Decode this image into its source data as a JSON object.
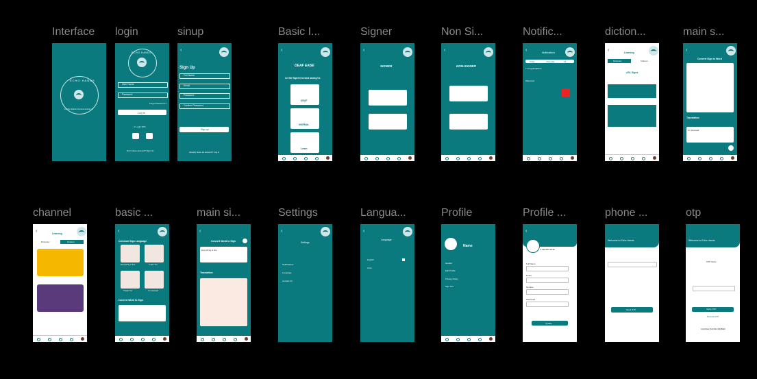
{
  "frames": [
    {
      "label": "Interface"
    },
    {
      "label": "login"
    },
    {
      "label": "sinup"
    },
    {
      "label": "Basic I..."
    },
    {
      "label": "Signer"
    },
    {
      "label": "Non Si..."
    },
    {
      "label": "Notific..."
    },
    {
      "label": "diction..."
    },
    {
      "label": "main s..."
    },
    {
      "label": "channel"
    },
    {
      "label": "basic ..."
    },
    {
      "label": "main si..."
    },
    {
      "label": "Settings"
    },
    {
      "label": "Langua..."
    },
    {
      "label": "Profile"
    },
    {
      "label": "Profile ..."
    },
    {
      "label": "phone ..."
    },
    {
      "label": "otp"
    }
  ],
  "splash": {
    "brand": "ECHO HANDS",
    "tagline": "Let the Signers be best among us"
  },
  "login": {
    "brand": "ECHO HANDS",
    "user": "User Name",
    "password": "Password",
    "forgot": "Forgot Password ?",
    "login": "Log in",
    "or": "or Login With",
    "signup_prompt": "Don't Have account? Sign Up"
  },
  "signup": {
    "title": "Sign Up",
    "fields": [
      "Full Name",
      "Email",
      "Password",
      "Confirm Password"
    ],
    "button": "Sign up",
    "login_prompt": "Already Have an account? Log in"
  },
  "basic": {
    "title": "DEAF EASE",
    "subtitle": "Let the Signers be best among Us",
    "options": [
      "DEAF",
      "NORMAL",
      "Learn"
    ]
  },
  "signer": {
    "title": "SIGNER"
  },
  "nonsigner": {
    "title": "NON-SIGNER"
  },
  "notif": {
    "title": "Notifications",
    "tabs": [
      "Today",
      "Yesterday",
      "All"
    ],
    "items": [
      "7 Congratulations",
      "Welcome!",
      "Delete"
    ]
  },
  "dict": {
    "title": "Learning",
    "tabs": [
      "Dictionary",
      "Channel"
    ],
    "heading": "ASL Signs"
  },
  "mainsign": {
    "title": "Convert Sign to Word",
    "translation": "Translation",
    "result": "I'm stressed"
  },
  "channel": {
    "title": "Learning",
    "tabs": [
      "Dictionary",
      "Channel"
    ]
  },
  "basicsign": {
    "title": "Common Sign Language",
    "items": [
      "Everything is fine",
      "I Hate You",
      "Thank You",
      "I'm stressed"
    ],
    "convert": "Convert Word to Sign"
  },
  "mainword": {
    "title": "Convert Word to Sign",
    "input": "Everything is fine",
    "translation": "Translation"
  },
  "settings": {
    "title": "Settings",
    "items": [
      "Notifications",
      "Language",
      "Contact Us"
    ]
  },
  "language": {
    "title": "Language",
    "items": [
      "English",
      "Urdu"
    ]
  },
  "profile": {
    "name": "Name",
    "items": [
      "Gender",
      "Edit Profile",
      "Privacy Policy",
      "Sign Out"
    ]
  },
  "profileedit": {
    "name": "A.HEFMKHANE",
    "fields": [
      "Full Name",
      "Email",
      "Number",
      "Password"
    ],
    "button": "Update"
  },
  "phone": {
    "welcome": "Welcome to Echo Hands",
    "button": "Send OTP"
  },
  "otp": {
    "welcome": "Welcome to Echo Hands",
    "heading": "OTP Verify",
    "button": "Verify OTP",
    "resend": "Resend OTP",
    "footer": "CHANGE PHONE NUMBER"
  },
  "colors": {
    "teal": "#0a7a7e",
    "label": "#8a8a8a"
  }
}
